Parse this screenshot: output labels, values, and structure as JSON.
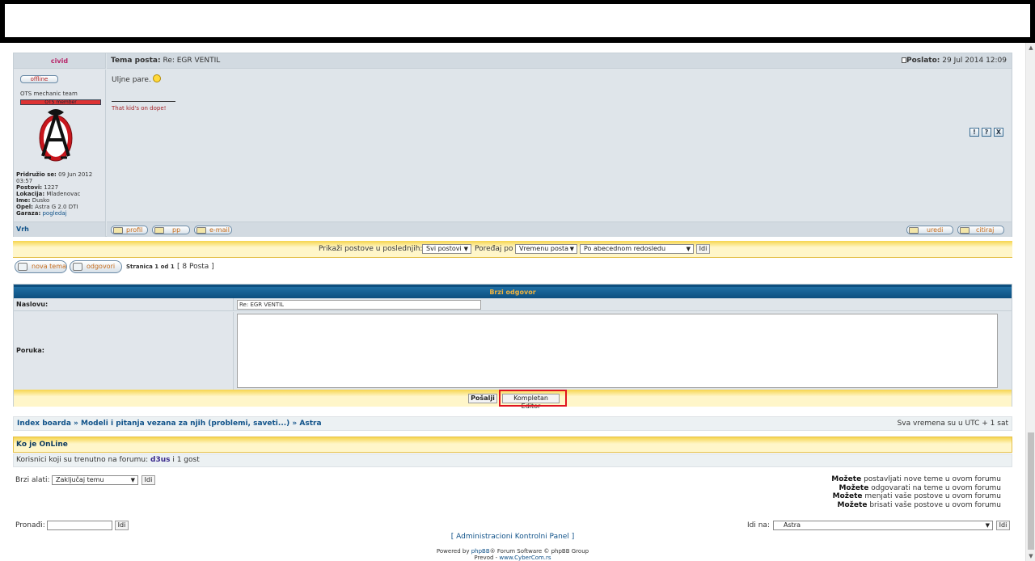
{
  "post": {
    "author": "civid",
    "subject_label": "Tema posta:",
    "subject": "Re: EGR VENTIL",
    "posted_label": "Poslato:",
    "posted_date": "29 Jul 2014 12:09",
    "status": "offline",
    "rank": "OTS mechanic team",
    "rank_bar_text": "OTS member",
    "joined_label": "Pridružio se:",
    "joined_value": "09 Jun 2012 03:57",
    "posts_label": "Postovi:",
    "posts_value": "1227",
    "location_label": "Lokacija:",
    "location_value": "Mladenovac",
    "name_label": "Ime:",
    "name_value": "Dusko",
    "car_label": "Opel:",
    "car_value": "Astra G 2.0 DTI",
    "garage_label": "Garaza:",
    "garage_link": "pogledaj",
    "message": "Uljne pare.",
    "signature": "That kid's on dope!",
    "top_link": "Vrh",
    "buttons": {
      "profile": "profil",
      "pm": "pp",
      "email": "e-mail",
      "edit": "uredi",
      "quote": "citiraj"
    },
    "mini_icons": [
      "!",
      "?",
      "X"
    ]
  },
  "filter": {
    "show_label": "Prikaži postove u poslednjih:",
    "show_value": "Svi postovi",
    "sort_label": "Poređaj po",
    "sort_value": "Vremenu posta",
    "order_value": "Po abecednom redosledu",
    "go": "Idi"
  },
  "pagination": {
    "new_topic": "nova tema",
    "reply": "odgovori",
    "page_text": "Stranica 1 od 1",
    "count_text": "[ 8 Posta ]"
  },
  "quick_reply": {
    "title": "Brzi odgovor",
    "subject_label": "Naslovu:",
    "subject_value": "Re: EGR VENTIL",
    "message_label": "Poruka:",
    "send": "Pošalji",
    "full_editor": "Kompletan Editor"
  },
  "breadcrumb": {
    "home": "Index boarda",
    "sep": "»",
    "forum": "Modeli i pitanja vezana za njih (problemi, saveti...)",
    "subforum": "Astra",
    "timezone": "Sva vremena su u UTC + 1 sat"
  },
  "online": {
    "title": "Ko je OnLine",
    "text": "Korisnici koji su trenutno na forumu:",
    "user": "d3us",
    "guests": "i 1 gost"
  },
  "tools": {
    "label": "Brzi alati:",
    "value": "Zaključaj temu",
    "go": "Idi"
  },
  "permissions": [
    {
      "bold": "Možete",
      "rest": "postavljati nove teme u ovom forumu"
    },
    {
      "bold": "Možete",
      "rest": "odgovarati na teme u ovom forumu"
    },
    {
      "bold": "Možete",
      "rest": "menjati vaše postove u ovom forumu"
    },
    {
      "bold": "Možete",
      "rest": "brisati vaše postove u ovom forumu"
    }
  ],
  "search": {
    "label": "Pronađi:",
    "go": "Idi"
  },
  "jump": {
    "label": "Idi na:",
    "value": "Astra",
    "go": "Idi"
  },
  "footer": {
    "admin_link": "[ Administracioni Kontrolni Panel ]",
    "powered_pre": "Powered by",
    "phpbb": "phpBB",
    "powered_post": "® Forum Software © phpBB Group",
    "translation_pre": "Prevod -",
    "translation_link": "www.CyberCom.rs"
  }
}
